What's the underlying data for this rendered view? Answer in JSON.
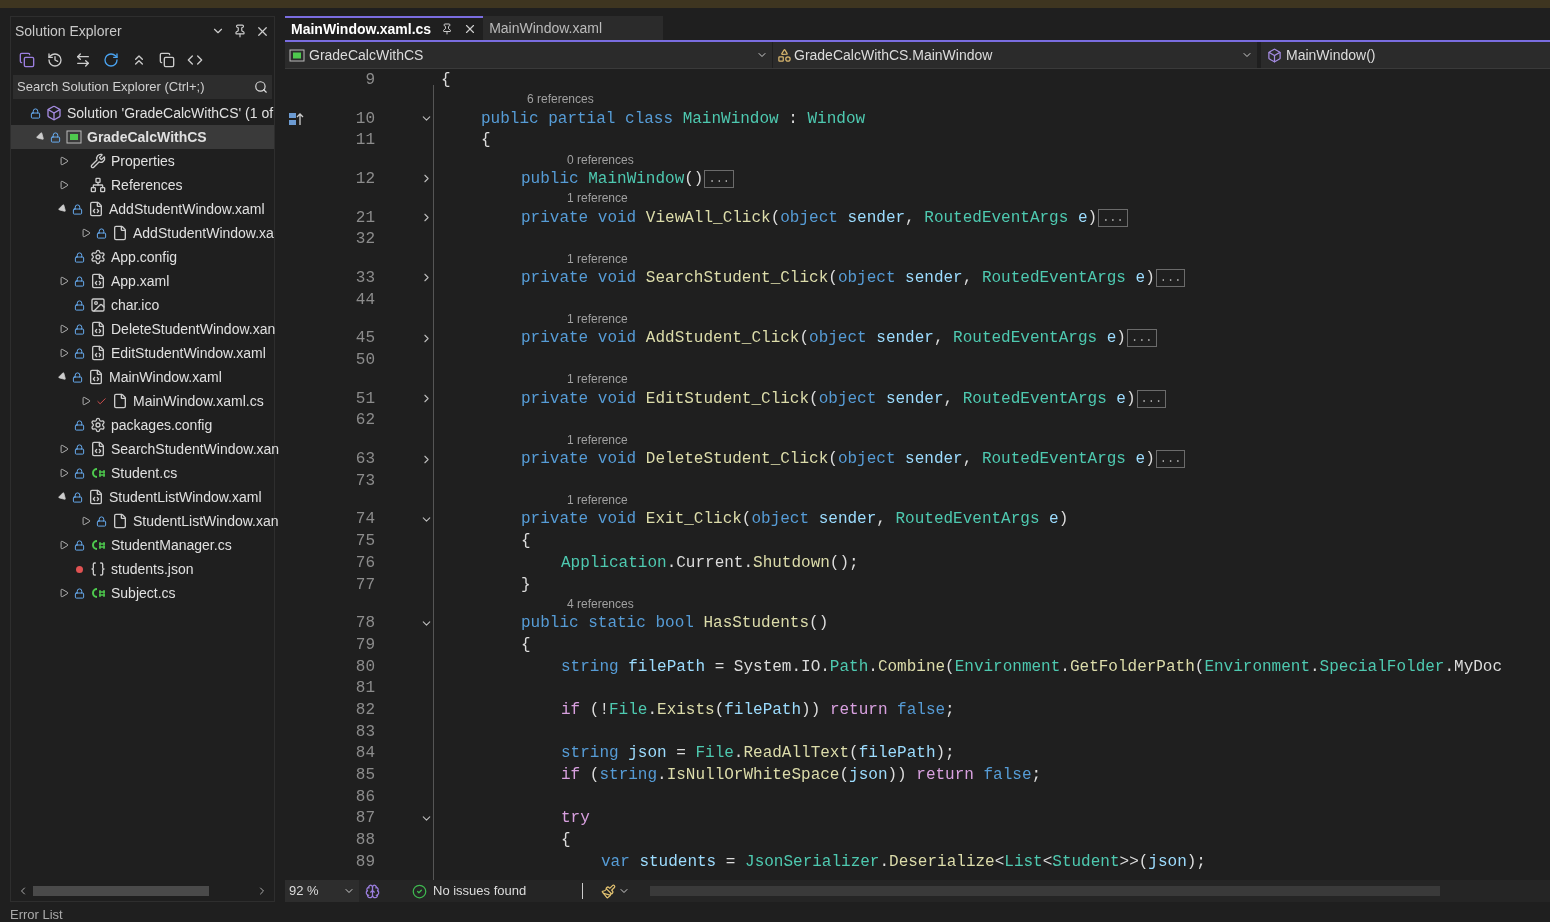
{
  "solution_explorer": {
    "title": "Solution Explorer",
    "search": {
      "placeholder": "Search Solution Explorer (Ctrl+;)"
    },
    "tree": [
      {
        "label": "Solution 'GradeCalcWithCS' (1 of",
        "kind": "solution",
        "locked": true,
        "pending": false,
        "excluded": false,
        "expandable": false,
        "selected": false,
        "children": [
          {
            "label": "GradeCalcWithCS",
            "kind": "project",
            "locked": true,
            "pending": false,
            "excluded": false,
            "expandable": true,
            "expanded": true,
            "selected": true,
            "children": [
              {
                "label": "Properties",
                "kind": "wrench",
                "locked": false,
                "pending": false,
                "excluded": false,
                "expandable": true,
                "expanded": false,
                "selected": false
              },
              {
                "label": "References",
                "kind": "references",
                "locked": false,
                "pending": false,
                "excluded": false,
                "expandable": true,
                "expanded": false,
                "selected": false
              },
              {
                "label": "AddStudentWindow.xaml",
                "kind": "xaml",
                "locked": true,
                "pending": false,
                "excluded": false,
                "expandable": true,
                "expanded": true,
                "selected": false,
                "children": [
                  {
                    "label": "AddStudentWindow.xa",
                    "kind": "codefile",
                    "locked": true,
                    "pending": false,
                    "excluded": false,
                    "expandable": true,
                    "expanded": false,
                    "selected": false
                  }
                ]
              },
              {
                "label": "App.config",
                "kind": "config",
                "locked": true,
                "pending": false,
                "excluded": false,
                "expandable": false,
                "selected": false
              },
              {
                "label": "App.xaml",
                "kind": "xaml",
                "locked": true,
                "pending": false,
                "excluded": false,
                "expandable": true,
                "expanded": false,
                "selected": false
              },
              {
                "label": "char.ico",
                "kind": "image",
                "locked": true,
                "pending": false,
                "excluded": false,
                "expandable": false,
                "selected": false
              },
              {
                "label": "DeleteStudentWindow.xan",
                "kind": "xaml",
                "locked": true,
                "pending": false,
                "excluded": false,
                "expandable": true,
                "expanded": false,
                "selected": false
              },
              {
                "label": "EditStudentWindow.xaml",
                "kind": "xaml",
                "locked": true,
                "pending": false,
                "excluded": false,
                "expandable": true,
                "expanded": false,
                "selected": false
              },
              {
                "label": "MainWindow.xaml",
                "kind": "xaml",
                "locked": true,
                "pending": false,
                "excluded": false,
                "expandable": true,
                "expanded": true,
                "selected": false,
                "children": [
                  {
                    "label": "MainWindow.xaml.cs",
                    "kind": "codefile",
                    "locked": false,
                    "pending": true,
                    "excluded": false,
                    "expandable": true,
                    "expanded": false,
                    "selected": false
                  }
                ]
              },
              {
                "label": "packages.config",
                "kind": "config",
                "locked": true,
                "pending": false,
                "excluded": false,
                "expandable": false,
                "selected": false
              },
              {
                "label": "SearchStudentWindow.xan",
                "kind": "xaml",
                "locked": true,
                "pending": false,
                "excluded": false,
                "expandable": true,
                "expanded": false,
                "selected": false
              },
              {
                "label": "Student.cs",
                "kind": "csharp",
                "locked": true,
                "pending": false,
                "excluded": false,
                "expandable": true,
                "expanded": false,
                "selected": false
              },
              {
                "label": "StudentListWindow.xaml",
                "kind": "xaml",
                "locked": true,
                "pending": false,
                "excluded": false,
                "expandable": true,
                "expanded": true,
                "selected": false,
                "children": [
                  {
                    "label": "StudentListWindow.xan",
                    "kind": "codefile",
                    "locked": true,
                    "pending": false,
                    "excluded": false,
                    "expandable": true,
                    "expanded": false,
                    "selected": false
                  }
                ]
              },
              {
                "label": "StudentManager.cs",
                "kind": "csharp",
                "locked": true,
                "pending": false,
                "excluded": false,
                "expandable": true,
                "expanded": false,
                "selected": false
              },
              {
                "label": "students.json",
                "kind": "json",
                "locked": false,
                "pending": false,
                "excluded": true,
                "expandable": false,
                "selected": false
              },
              {
                "label": "Subject.cs",
                "kind": "csharp",
                "locked": true,
                "pending": false,
                "excluded": false,
                "expandable": true,
                "expanded": false,
                "selected": false
              }
            ]
          }
        ]
      }
    ]
  },
  "editor": {
    "tabs": [
      {
        "label": "MainWindow.xaml.cs",
        "selected": true
      },
      {
        "label": "MainWindow.xaml",
        "selected": false
      }
    ],
    "nav": {
      "project": "GradeCalcWithCS",
      "type": "GradeCalcWithCS.MainWindow",
      "member": "MainWindow()"
    },
    "lines": [
      {
        "kind": "code",
        "number": "9",
        "foldable": false,
        "tokens": [
          {
            "kind": "open",
            "t": "{"
          }
        ]
      },
      {
        "kind": "lens",
        "text": "6 references"
      },
      {
        "kind": "code",
        "number": "10",
        "foldable": true,
        "folded": false,
        "marker": true,
        "tokens": [
          {
            "kind": "kw",
            "t": "public partial class "
          },
          {
            "kind": "type",
            "t": "MainWindow"
          },
          {
            "kind": "punct",
            "t": " : "
          },
          {
            "kind": "type",
            "t": "Window"
          }
        ]
      },
      {
        "kind": "code",
        "number": "11",
        "foldable": false,
        "tokens": [
          {
            "kind": "open",
            "t": "{"
          }
        ]
      },
      {
        "kind": "lens",
        "text": "0 references"
      },
      {
        "kind": "code",
        "number": "12",
        "foldable": true,
        "folded": true,
        "ellipsis": "...",
        "tokens": [
          {
            "kind": "kw",
            "t": "public "
          },
          {
            "kind": "type",
            "t": "MainWindow"
          },
          {
            "kind": "punct",
            "t": "()"
          }
        ]
      },
      {
        "kind": "lens",
        "text": "1 reference"
      },
      {
        "kind": "code",
        "number": "21",
        "foldable": true,
        "folded": true,
        "ellipsis": "...",
        "tokens": [
          {
            "kind": "kw",
            "t": "private void "
          },
          {
            "kind": "method",
            "t": "ViewAll_Click"
          },
          {
            "kind": "punct",
            "t": "("
          },
          {
            "kind": "kw",
            "t": "object "
          },
          {
            "kind": "ident",
            "t": "sender"
          },
          {
            "kind": "punct",
            "t": ", "
          },
          {
            "kind": "type",
            "t": "RoutedEventArgs "
          },
          {
            "kind": "ident",
            "t": "e"
          },
          {
            "kind": "punct",
            "t": ")"
          }
        ]
      },
      {
        "kind": "code",
        "number": "32",
        "foldable": false
      },
      {
        "kind": "lens",
        "text": "1 reference"
      },
      {
        "kind": "code",
        "number": "33",
        "foldable": true,
        "folded": true,
        "ellipsis": "...",
        "tokens": [
          {
            "kind": "kw",
            "t": "private void "
          },
          {
            "kind": "method",
            "t": "SearchStudent_Click"
          },
          {
            "kind": "punct",
            "t": "("
          },
          {
            "kind": "kw",
            "t": "object "
          },
          {
            "kind": "ident",
            "t": "sender"
          },
          {
            "kind": "punct",
            "t": ", "
          },
          {
            "kind": "type",
            "t": "RoutedEventArgs "
          },
          {
            "kind": "ident",
            "t": "e"
          },
          {
            "kind": "punct",
            "t": ")"
          }
        ]
      },
      {
        "kind": "code",
        "number": "44",
        "foldable": false
      },
      {
        "kind": "lens",
        "text": "1 reference"
      },
      {
        "kind": "code",
        "number": "45",
        "foldable": true,
        "folded": true,
        "ellipsis": "...",
        "tokens": [
          {
            "kind": "kw",
            "t": "private void "
          },
          {
            "kind": "method",
            "t": "AddStudent_Click"
          },
          {
            "kind": "punct",
            "t": "("
          },
          {
            "kind": "kw",
            "t": "object "
          },
          {
            "kind": "ident",
            "t": "sender"
          },
          {
            "kind": "punct",
            "t": ", "
          },
          {
            "kind": "type",
            "t": "RoutedEventArgs "
          },
          {
            "kind": "ident",
            "t": "e"
          },
          {
            "kind": "punct",
            "t": ")"
          }
        ]
      },
      {
        "kind": "code",
        "number": "50",
        "foldable": false
      },
      {
        "kind": "lens",
        "text": "1 reference"
      },
      {
        "kind": "code",
        "number": "51",
        "foldable": true,
        "folded": true,
        "ellipsis": "...",
        "tokens": [
          {
            "kind": "kw",
            "t": "private void "
          },
          {
            "kind": "method",
            "t": "EditStudent_Click"
          },
          {
            "kind": "punct",
            "t": "("
          },
          {
            "kind": "kw",
            "t": "object "
          },
          {
            "kind": "ident",
            "t": "sender"
          },
          {
            "kind": "punct",
            "t": ", "
          },
          {
            "kind": "type",
            "t": "RoutedEventArgs "
          },
          {
            "kind": "ident",
            "t": "e"
          },
          {
            "kind": "punct",
            "t": ")"
          }
        ]
      },
      {
        "kind": "code",
        "number": "62",
        "foldable": false
      },
      {
        "kind": "lens",
        "text": "1 reference"
      },
      {
        "kind": "code",
        "number": "63",
        "foldable": true,
        "folded": true,
        "ellipsis": "...",
        "tokens": [
          {
            "kind": "kw",
            "t": "private void "
          },
          {
            "kind": "method",
            "t": "DeleteStudent_Click"
          },
          {
            "kind": "punct",
            "t": "("
          },
          {
            "kind": "kw",
            "t": "object "
          },
          {
            "kind": "ident",
            "t": "sender"
          },
          {
            "kind": "punct",
            "t": ", "
          },
          {
            "kind": "type",
            "t": "RoutedEventArgs "
          },
          {
            "kind": "ident",
            "t": "e"
          },
          {
            "kind": "punct",
            "t": ")"
          }
        ]
      },
      {
        "kind": "code",
        "number": "73",
        "foldable": false
      },
      {
        "kind": "lens",
        "text": "1 reference"
      },
      {
        "kind": "code",
        "number": "74",
        "foldable": true,
        "folded": false,
        "tokens": [
          {
            "kind": "kw",
            "t": "private void "
          },
          {
            "kind": "method",
            "t": "Exit_Click"
          },
          {
            "kind": "punct",
            "t": "("
          },
          {
            "kind": "kw",
            "t": "object "
          },
          {
            "kind": "ident",
            "t": "sender"
          },
          {
            "kind": "punct",
            "t": ", "
          },
          {
            "kind": "type",
            "t": "RoutedEventArgs "
          },
          {
            "kind": "ident",
            "t": "e"
          },
          {
            "kind": "punct",
            "t": ")"
          }
        ]
      },
      {
        "kind": "code",
        "number": "75",
        "foldable": false,
        "tokens": [
          {
            "kind": "open",
            "t": "{"
          }
        ]
      },
      {
        "kind": "code",
        "number": "76",
        "foldable": false,
        "tokens": [
          {
            "kind": "type",
            "t": "Application"
          },
          {
            "kind": "punct",
            "t": ".Current."
          },
          {
            "kind": "method",
            "t": "Shutdown"
          },
          {
            "kind": "punct",
            "t": "();"
          }
        ]
      },
      {
        "kind": "code",
        "number": "77",
        "foldable": false,
        "tokens": [
          {
            "kind": "close",
            "t": "}"
          }
        ]
      },
      {
        "kind": "lens",
        "text": "4 references"
      },
      {
        "kind": "code",
        "number": "78",
        "foldable": true,
        "folded": false,
        "tokens": [
          {
            "kind": "kw",
            "t": "public static bool "
          },
          {
            "kind": "method",
            "t": "HasStudents"
          },
          {
            "kind": "punct",
            "t": "()"
          }
        ]
      },
      {
        "kind": "code",
        "number": "79",
        "foldable": false,
        "tokens": [
          {
            "kind": "open",
            "t": "{"
          }
        ]
      },
      {
        "kind": "code",
        "number": "80",
        "foldable": false,
        "tokens": [
          {
            "kind": "kw",
            "t": "string "
          },
          {
            "kind": "ident",
            "t": "filePath"
          },
          {
            "kind": "punct",
            "t": " = System.IO."
          },
          {
            "kind": "type",
            "t": "Path"
          },
          {
            "kind": "punct",
            "t": "."
          },
          {
            "kind": "method",
            "t": "Combine"
          },
          {
            "kind": "punct",
            "t": "("
          },
          {
            "kind": "type",
            "t": "Environment"
          },
          {
            "kind": "punct",
            "t": "."
          },
          {
            "kind": "method",
            "t": "GetFolderPath"
          },
          {
            "kind": "punct",
            "t": "("
          },
          {
            "kind": "type",
            "t": "Environment"
          },
          {
            "kind": "punct",
            "t": "."
          },
          {
            "kind": "type",
            "t": "SpecialFolder"
          },
          {
            "kind": "punct",
            "t": ".MyDoc"
          }
        ]
      },
      {
        "kind": "code",
        "number": "81",
        "foldable": false
      },
      {
        "kind": "code",
        "number": "82",
        "foldable": false,
        "tokens": [
          {
            "kind": "ctrl",
            "t": "if "
          },
          {
            "kind": "punct",
            "t": "(!"
          },
          {
            "kind": "type",
            "t": "File"
          },
          {
            "kind": "punct",
            "t": "."
          },
          {
            "kind": "method",
            "t": "Exists"
          },
          {
            "kind": "punct",
            "t": "("
          },
          {
            "kind": "ident",
            "t": "filePath"
          },
          {
            "kind": "punct",
            "t": ")) "
          },
          {
            "kind": "ctrl",
            "t": "return "
          },
          {
            "kind": "kw",
            "t": "false"
          },
          {
            "kind": "punct",
            "t": ";"
          }
        ]
      },
      {
        "kind": "code",
        "number": "83",
        "foldable": false
      },
      {
        "kind": "code",
        "number": "84",
        "foldable": false,
        "tokens": [
          {
            "kind": "kw",
            "t": "string "
          },
          {
            "kind": "ident",
            "t": "json"
          },
          {
            "kind": "punct",
            "t": " = "
          },
          {
            "kind": "type",
            "t": "File"
          },
          {
            "kind": "punct",
            "t": "."
          },
          {
            "kind": "method",
            "t": "ReadAllText"
          },
          {
            "kind": "punct",
            "t": "("
          },
          {
            "kind": "ident",
            "t": "filePath"
          },
          {
            "kind": "punct",
            "t": ");"
          }
        ]
      },
      {
        "kind": "code",
        "number": "85",
        "foldable": false,
        "tokens": [
          {
            "kind": "ctrl",
            "t": "if "
          },
          {
            "kind": "punct",
            "t": "("
          },
          {
            "kind": "kw",
            "t": "string"
          },
          {
            "kind": "punct",
            "t": "."
          },
          {
            "kind": "method",
            "t": "IsNullOrWhiteSpace"
          },
          {
            "kind": "punct",
            "t": "("
          },
          {
            "kind": "ident",
            "t": "json"
          },
          {
            "kind": "punct",
            "t": ")) "
          },
          {
            "kind": "ctrl",
            "t": "return "
          },
          {
            "kind": "kw",
            "t": "false"
          },
          {
            "kind": "punct",
            "t": ";"
          }
        ]
      },
      {
        "kind": "code",
        "number": "86",
        "foldable": false
      },
      {
        "kind": "code",
        "number": "87",
        "foldable": true,
        "folded": false,
        "tokens": [
          {
            "kind": "ctrl",
            "t": "try"
          }
        ]
      },
      {
        "kind": "code",
        "number": "88",
        "foldable": false,
        "tokens": [
          {
            "kind": "open",
            "t": "{"
          }
        ]
      },
      {
        "kind": "code",
        "number": "89",
        "foldable": false,
        "tokens": [
          {
            "kind": "kw",
            "t": "var "
          },
          {
            "kind": "ident",
            "t": "students"
          },
          {
            "kind": "punct",
            "t": " = "
          },
          {
            "kind": "type",
            "t": "JsonSerializer"
          },
          {
            "kind": "punct",
            "t": "."
          },
          {
            "kind": "method",
            "t": "Deserialize"
          },
          {
            "kind": "punct",
            "t": "<"
          },
          {
            "kind": "type",
            "t": "List"
          },
          {
            "kind": "punct",
            "t": "<"
          },
          {
            "kind": "type",
            "t": "Student"
          },
          {
            "kind": "punct",
            "t": ">>("
          },
          {
            "kind": "ident",
            "t": "json"
          },
          {
            "kind": "punct",
            "t": ");"
          }
        ]
      }
    ]
  },
  "status_bar": {
    "zoom": "92 %",
    "issues": "No issues found"
  },
  "bottom_panel": {
    "title": "Error List"
  }
}
